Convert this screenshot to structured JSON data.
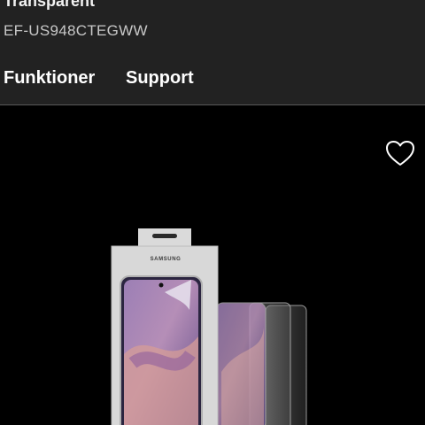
{
  "product": {
    "name": "Transparent",
    "model_code": "EF-US948CTEGWW",
    "box_brand": "SAMSUNG"
  },
  "tabs": [
    {
      "label": "Funktioner"
    },
    {
      "label": "Support"
    }
  ],
  "icons": {
    "wishlist": "heart-outline-icon"
  },
  "colors": {
    "header_bg": "#222222",
    "page_bg": "#000000",
    "text_primary": "#ffffff",
    "text_secondary": "#c8c8c8"
  }
}
